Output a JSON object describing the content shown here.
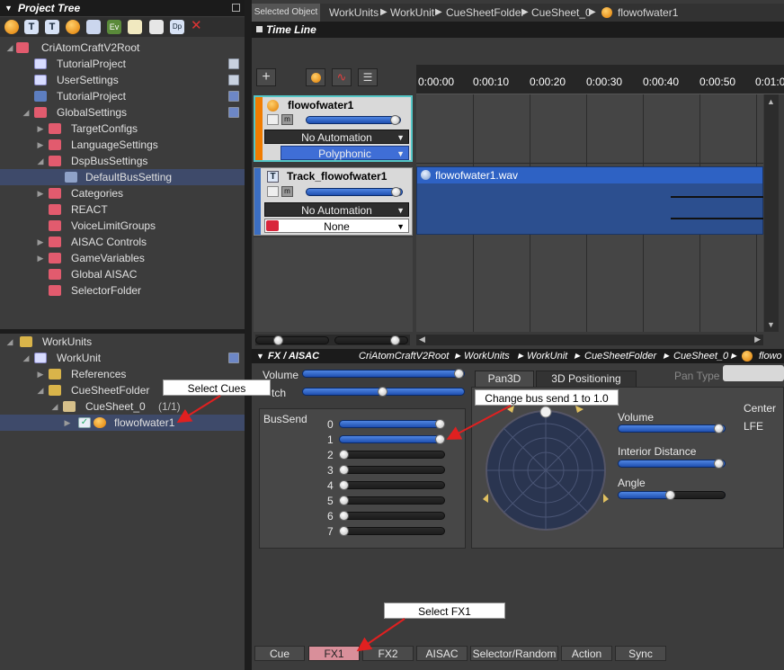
{
  "project_tree": {
    "title": "Project Tree",
    "root_label": "CriAtomCraftV2Root",
    "items": [
      {
        "label": "TutorialProject"
      },
      {
        "label": "UserSettings"
      },
      {
        "label": "TutorialProject"
      },
      {
        "label": "GlobalSettings"
      },
      {
        "label": "TargetConfigs"
      },
      {
        "label": "LanguageSettings"
      },
      {
        "label": "DspBusSettings"
      },
      {
        "label": "DefaultBusSetting"
      },
      {
        "label": "Categories"
      },
      {
        "label": "REACT"
      },
      {
        "label": "VoiceLimitGroups"
      },
      {
        "label": "AISAC Controls"
      },
      {
        "label": "GameVariables"
      },
      {
        "label": "Global AISAC"
      },
      {
        "label": "SelectorFolder"
      }
    ]
  },
  "workunits_tree": {
    "items": [
      {
        "label": "WorkUnits"
      },
      {
        "label": "WorkUnit"
      },
      {
        "label": "References"
      },
      {
        "label": "CueSheetFolder"
      },
      {
        "label": "CueSheet_0"
      },
      {
        "label": "flowofwater1"
      }
    ],
    "cuesheet_count": "(1/1)"
  },
  "breadcrumb": {
    "label": "Selected Object",
    "items": [
      "WorkUnits",
      "WorkUnit",
      "CueSheetFolder",
      "CueSheet_0",
      "flowofwater1"
    ]
  },
  "timeline": {
    "title": "Time Line",
    "ticks": [
      "0:00:00",
      "0:00:10",
      "0:00:20",
      "0:00:30",
      "0:00:40",
      "0:00:50",
      "0:01:0"
    ],
    "cue_name": "flowofwater1",
    "cue_automation": "No Automation",
    "cue_mode": "Polyphonic",
    "track_name": "Track_flowofwater1",
    "track_automation": "No Automation",
    "track_select": "None",
    "waveform_name": "flowofwater1.wav"
  },
  "fx_panel": {
    "title": "FX / AISAC",
    "path": [
      "CriAtomCraftV2Root",
      "WorkUnits",
      "WorkUnit",
      "CueSheetFolder",
      "CueSheet_0",
      "flowo"
    ],
    "volume_label": "Volume",
    "pitch_label": "tch",
    "bussend_label": "BusSend",
    "bus_rows": [
      {
        "label": "0",
        "value": 1.0
      },
      {
        "label": "1",
        "value": 1.0
      },
      {
        "label": "2",
        "value": 0
      },
      {
        "label": "3",
        "value": 0
      },
      {
        "label": "4",
        "value": 0
      },
      {
        "label": "5",
        "value": 0
      },
      {
        "label": "6",
        "value": 0
      },
      {
        "label": "7",
        "value": 0
      }
    ],
    "pan_tabs": [
      "Pan3D",
      "3D Positioning"
    ],
    "pan_type_label": "Pan Type",
    "pan_volume_label": "Volume",
    "interior_distance_label": "Interior Distance",
    "angle_label": "Angle",
    "center_label": "Center",
    "lfe_label": "LFE"
  },
  "bottom_tabs": [
    "Cue",
    "FX1",
    "FX2",
    "AISAC",
    "Selector/Random",
    "Action",
    "Sync"
  ],
  "callouts": {
    "select_cues": "Select Cues",
    "change_bus": "Change bus send 1 to 1.0",
    "select_fx1": "Select FX1"
  },
  "colors": {
    "accent_blue": "#2f6fd8",
    "cue_orange": "#f07c00",
    "selection": "#3e4a6a",
    "arrow_red": "#e02020"
  }
}
